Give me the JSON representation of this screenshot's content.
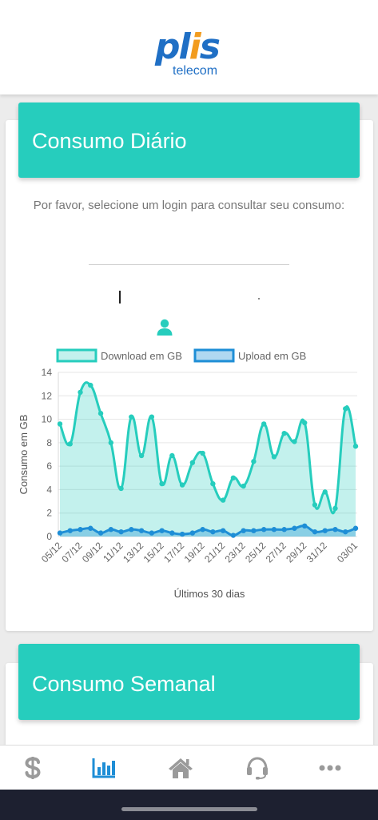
{
  "brand": {
    "logo_main": "plis",
    "logo_sub": "telecom"
  },
  "daily": {
    "title": "Consumo Diário",
    "instruction": "Por favor, selecione um login para consultar seu consumo:"
  },
  "weekly": {
    "title": "Consumo Semanal"
  },
  "nav": [
    {
      "name": "billing",
      "icon": "dollar-icon",
      "active": false
    },
    {
      "name": "consumption",
      "icon": "bar-chart-icon",
      "active": true
    },
    {
      "name": "home",
      "icon": "home-icon",
      "active": false
    },
    {
      "name": "support",
      "icon": "headset-icon",
      "active": false
    },
    {
      "name": "more",
      "icon": "ellipsis-icon",
      "active": false
    }
  ],
  "colors": {
    "accent": "#26cdbd",
    "upload": "#1e8ed6",
    "nav_active": "#1e8ed6",
    "nav_inactive": "#9a9a9a"
  },
  "chart_data": {
    "type": "area",
    "xlabel": "Últimos 30 dias",
    "ylabel": "Consumo em GB",
    "ylim": [
      0,
      14
    ],
    "yticks": [
      0,
      2,
      4,
      6,
      8,
      10,
      12,
      14
    ],
    "legend_position": "top",
    "x_tick_labels": [
      "05/12",
      "07/12",
      "09/12",
      "11/12",
      "13/12",
      "15/12",
      "17/12",
      "19/12",
      "21/12",
      "23/12",
      "25/12",
      "27/12",
      "29/12",
      "31/12",
      "03/01"
    ],
    "series": [
      {
        "name": "Download em GB",
        "color": "#26cdbd",
        "fill": "rgba(38,205,189,0.28)",
        "values": [
          9.6,
          7.9,
          12.3,
          12.9,
          10.5,
          8.0,
          4.1,
          10.2,
          6.9,
          10.2,
          4.5,
          6.9,
          4.4,
          6.3,
          7.1,
          4.5,
          3.1,
          5.0,
          4.3,
          6.4,
          9.6,
          6.8,
          8.8,
          8.1,
          9.7,
          2.7,
          3.8,
          2.4,
          10.9,
          7.7
        ]
      },
      {
        "name": "Upload em GB",
        "color": "#1e8ed6",
        "fill": "rgba(30,142,214,0.35)",
        "values": [
          0.3,
          0.5,
          0.6,
          0.7,
          0.3,
          0.6,
          0.4,
          0.6,
          0.5,
          0.3,
          0.5,
          0.3,
          0.2,
          0.3,
          0.6,
          0.4,
          0.5,
          0.1,
          0.5,
          0.5,
          0.6,
          0.6,
          0.6,
          0.7,
          0.9,
          0.4,
          0.5,
          0.6,
          0.4,
          0.7
        ]
      }
    ]
  }
}
